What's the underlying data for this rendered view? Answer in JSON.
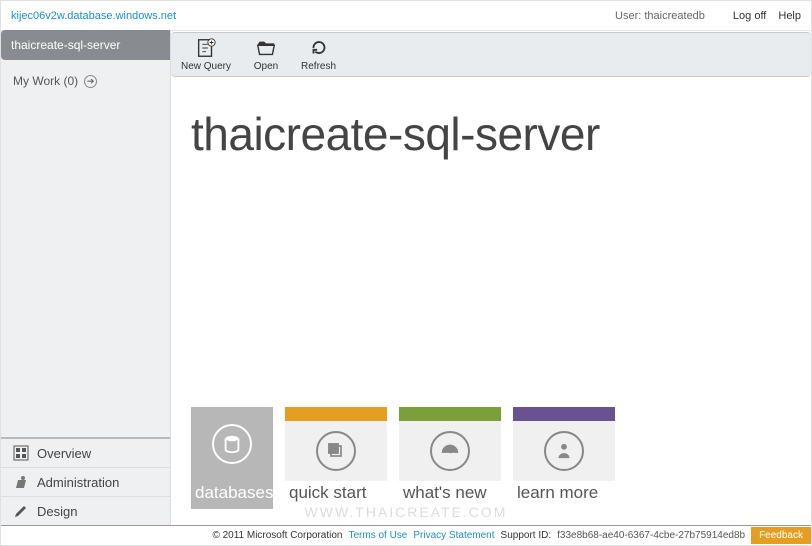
{
  "topbar": {
    "host": "kijec06v2w.database.windows.net",
    "user_prefix": "User:",
    "user_name": "thaicreatedb",
    "logoff": "Log off",
    "help": "Help"
  },
  "sidebar": {
    "tab": "thaicreate-sql-server",
    "mywork_label": "My Work (0)",
    "nav": [
      {
        "label": "Overview"
      },
      {
        "label": "Administration"
      },
      {
        "label": "Design"
      }
    ]
  },
  "toolbar": {
    "new_query": "New Query",
    "open": "Open",
    "refresh": "Refresh"
  },
  "page_title": "thaicreate-sql-server",
  "tiles": [
    {
      "label": "databases"
    },
    {
      "label": "quick start"
    },
    {
      "label": "what's new"
    },
    {
      "label": "learn more"
    }
  ],
  "watermark": "WWW.THAICREATE.COM",
  "footer": {
    "copyright": "© 2011 Microsoft Corporation",
    "terms": "Terms of Use",
    "privacy": "Privacy Statement",
    "support_label": "Support ID:",
    "support_id": "f33e8b68-ae40-6367-4cbe-27b75914ed8b",
    "feedback": "Feedback"
  }
}
